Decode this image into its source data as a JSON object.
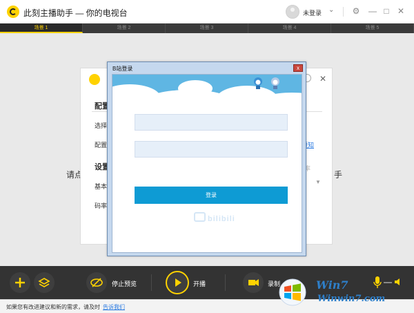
{
  "app": {
    "title": "此刻主播助手 — 你的电视台",
    "user_status": "未登录"
  },
  "scene_tabs": [
    "场景 1",
    "场景 2",
    "场景 3",
    "场景 4",
    "场景 5"
  ],
  "main": {
    "prompt_left": "请点",
    "prompt_right": "手"
  },
  "config_dialog": {
    "section1": "配置",
    "label_select": "选择",
    "label_config": "配置",
    "section2": "设置",
    "label_basic": "基本",
    "label_bitrate": "码率",
    "link_right": "须知",
    "faint_right": "率"
  },
  "login_dialog": {
    "title": "B站登录",
    "close": "x",
    "login_button": "登录",
    "logo_text": "bilibili"
  },
  "toolbar": {
    "stop_preview": "停止预览",
    "start_live": "开播",
    "record": "录制"
  },
  "statusbar": {
    "text": "如果您有改进建议和新的需求，请及时",
    "link": "告诉我们"
  },
  "watermark": {
    "brand": "Win7",
    "url": "Winwin7.com"
  },
  "colors": {
    "accent": "#ffd200",
    "login_button": "#0e9bd4",
    "toolbar": "#333333"
  }
}
